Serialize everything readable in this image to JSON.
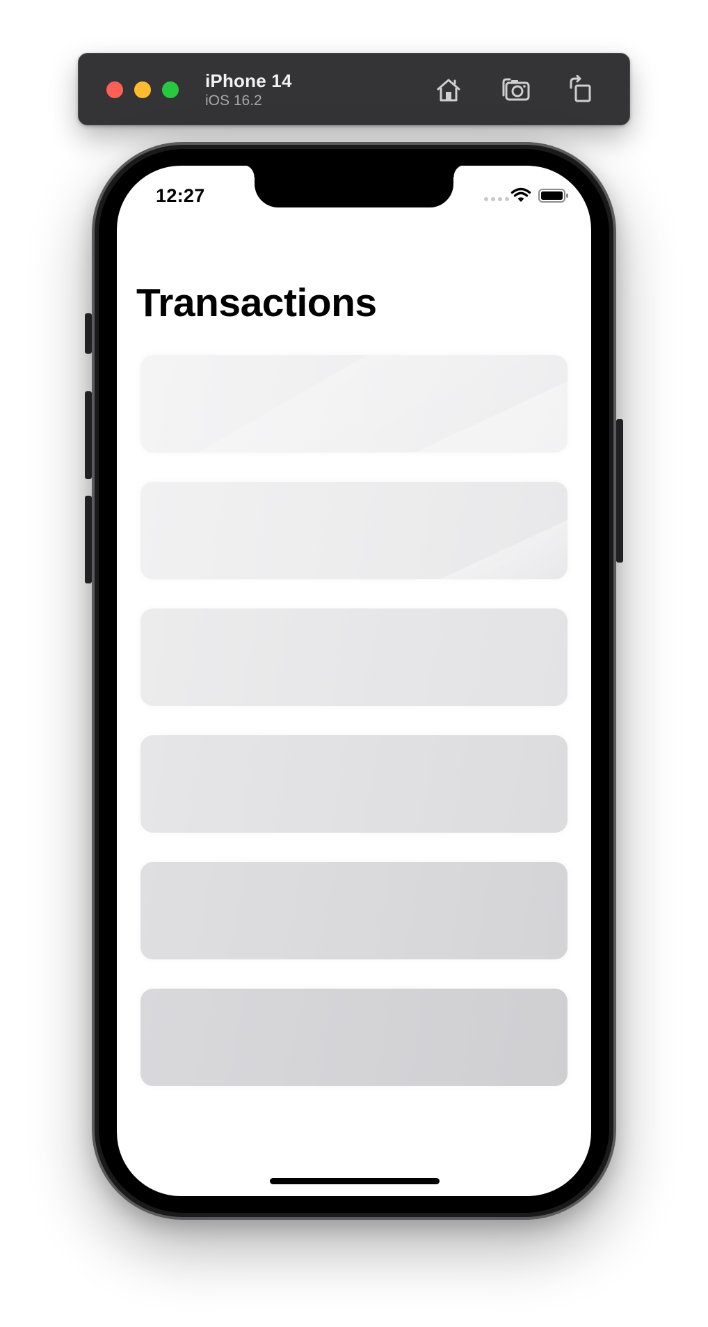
{
  "simulator": {
    "device_name": "iPhone 14",
    "os_version": "iOS 16.2",
    "window_controls": [
      "close",
      "minimize",
      "zoom"
    ],
    "toolbar_icons": [
      "home-icon",
      "screenshot-icon",
      "rotate-icon"
    ]
  },
  "status_bar": {
    "time": "12:27",
    "icons": [
      "signal-dots-icon",
      "wifi-icon",
      "battery-icon"
    ]
  },
  "screen": {
    "title": "Transactions",
    "placeholder_rows": 6
  }
}
